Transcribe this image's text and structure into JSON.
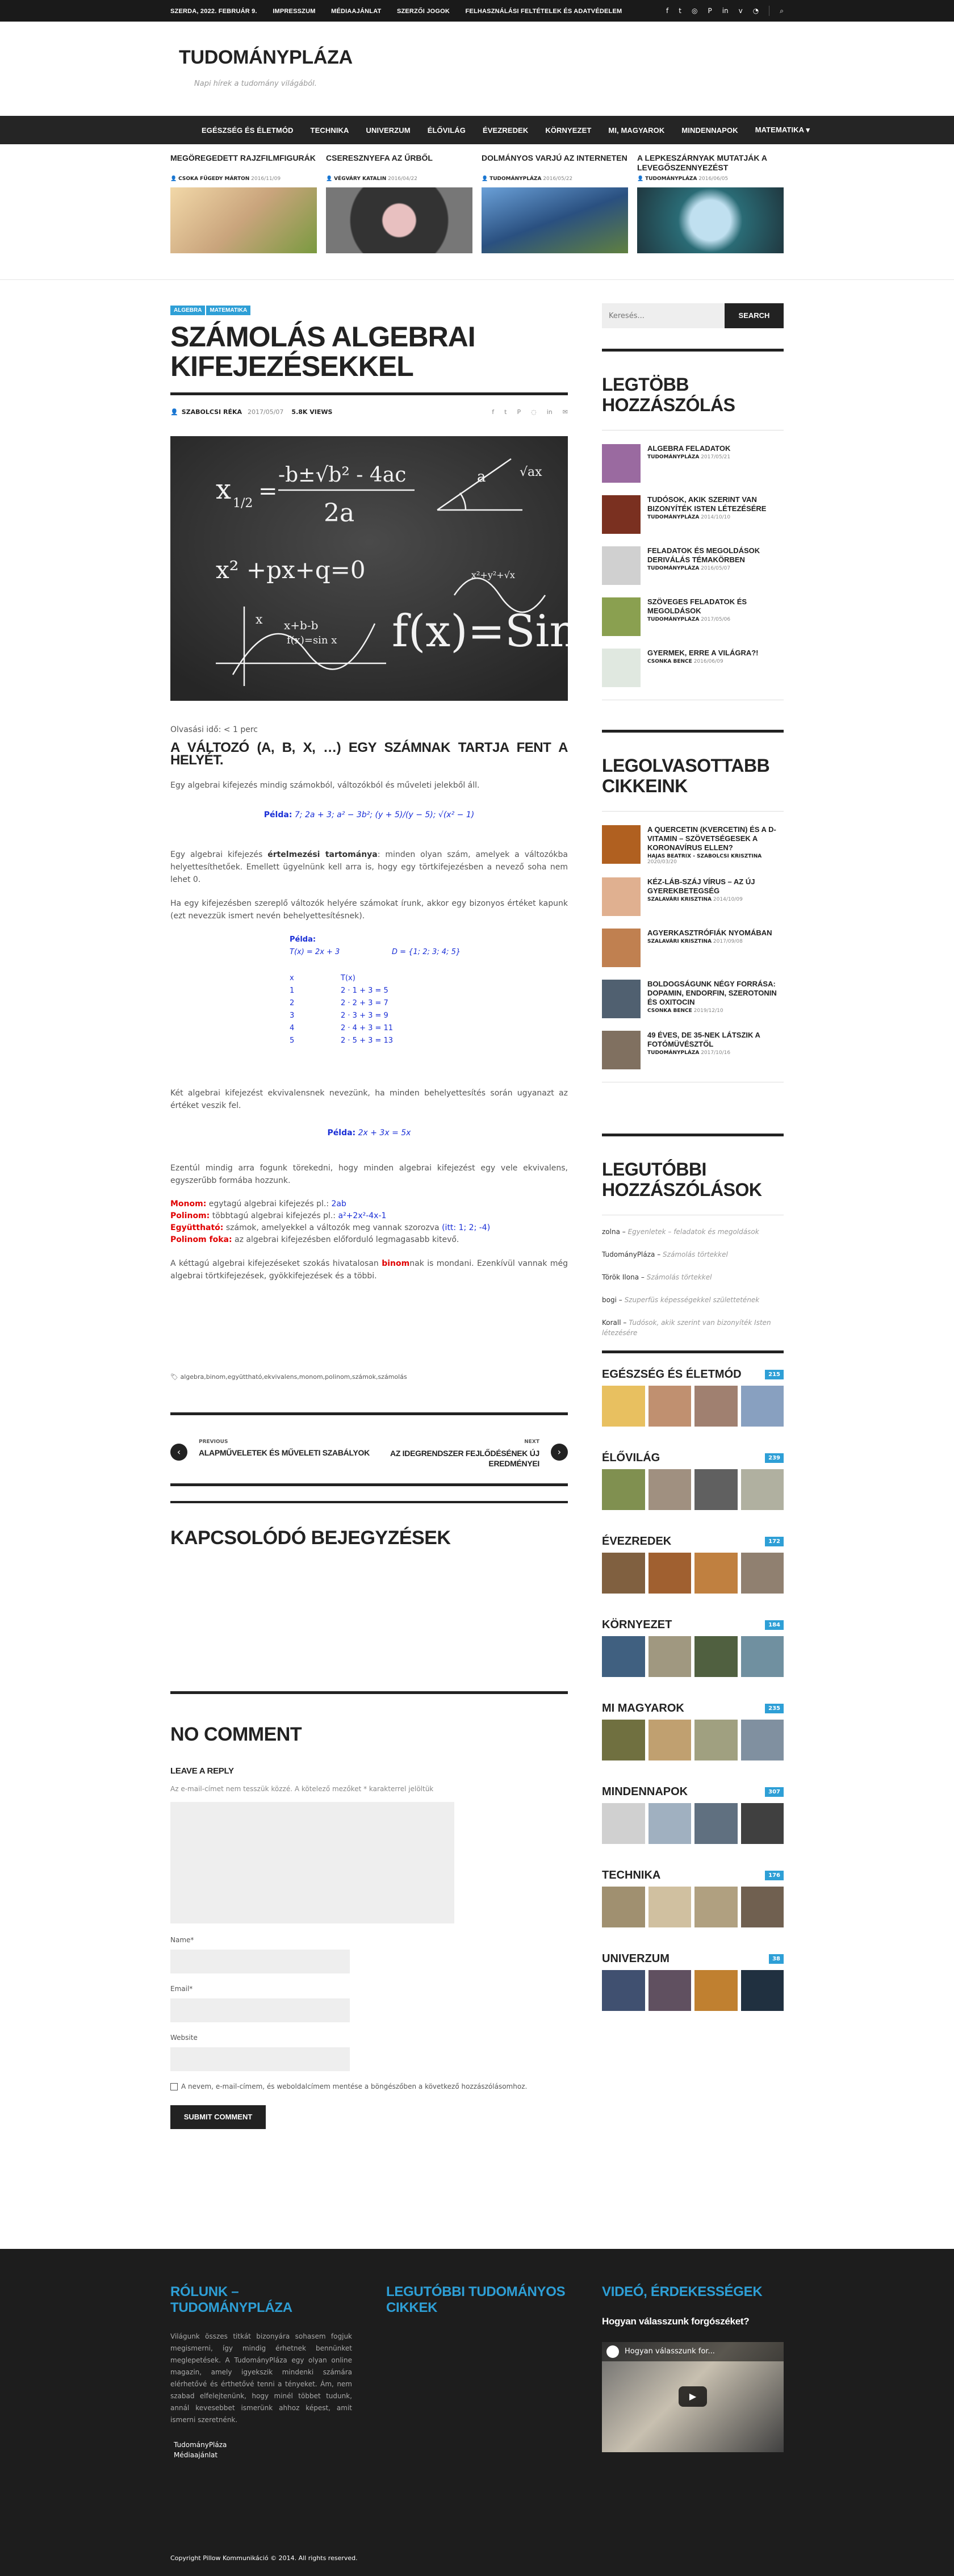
{
  "topbar": {
    "date": "SZERDA, 2022. FEBRUÁR 9.",
    "links": [
      "IMPRESSZUM",
      "MÉDIAAJÁNLAT",
      "SZERZŐI JOGOK",
      "FELHASZNÁLÁSI FELTÉTELEK ÉS ADATVÉDELEM"
    ],
    "social_icons": [
      "facebook-icon",
      "twitter-icon",
      "instagram-icon",
      "pinterest-icon",
      "linkedin-icon",
      "vimeo-icon",
      "rss-icon",
      "search-icon"
    ]
  },
  "header": {
    "logo": "TUDOMÁNYPLÁZA",
    "tagline": "Napi hírek a tudomány világából."
  },
  "nav": {
    "items": [
      "EGÉSZSÉG ÉS ÉLETMÓD",
      "TECHNIKA",
      "UNIVERZUM",
      "ÉLŐVILÁG",
      "ÉVEZREDEK",
      "KÖRNYEZET",
      "MI, MAGYAROK",
      "MINDENNAPOK",
      "MATEMATIKA ▾"
    ]
  },
  "featured": [
    {
      "title": "MEGÖREGEDETT RAJZFILMFIGURÁK",
      "author": "CSOKA FÜGEDY MÁRTON",
      "date": "2016/11/09",
      "color": "#c9a47c"
    },
    {
      "title": "CSERESZNYEFA AZ ŰRBŐL",
      "author": "VÉGVÁRY KATALIN",
      "date": "2016/04/22",
      "color": "#555"
    },
    {
      "title": "DOLMÁNYOS VARJÚ AZ INTERNETEN",
      "author": "TUDOMÁNYPLÁZA",
      "date": "2016/05/22",
      "color": "#3b6ea8"
    },
    {
      "title": "A LEPKESZÁRNYAK MUTATJÁK A LEVEGŐSZENNYEZÉST",
      "author": "TUDOMÁNYPLÁZA",
      "date": "2016/06/05",
      "color": "#2a6b75"
    }
  ],
  "article": {
    "categories": [
      "ALGEBRA",
      "MATEMATIKA"
    ],
    "title": "SZÁMOLÁS ALGEBRAI KIFEJEZÉSEKKEL",
    "author": "SZABOLCSI RÉKA",
    "date": "2017/05/07",
    "views": "5.8K VIEWS",
    "reading_time": "Olvasási idő: < 1 perc",
    "h_variable": "A VÁLTOZÓ (A, B, X, …) EGY SZÁMNAK TARTJA FENT A HELYÉT.",
    "p1": "Egy algebrai kifejezés mindig számokból, változókból és műveleti jelekből áll.",
    "example1_label": "Példa:",
    "example1": "7; 2a + 3; a² − 3b²; (y + 5)/(y − 5); √(x² − 1)",
    "p2_a": "Egy algebrai kifejezés ",
    "p2_b": "értelmezési tartománya",
    "p2_c": ": minden olyan szám, amelyek a változókba helyettesíthetőek. Emellett ügyelnünk kell arra is, hogy egy törtkifejezésben a nevező soha nem lehet 0.",
    "p3": "Ha egy kifejezésben szereplő változók helyére számokat írunk, akkor egy bizonyos értéket kapunk (ezt nevezzük ismert nevén behelyettesítésnek).",
    "example2_label": "Példa:",
    "example2_expr": "T(x) = 2x + 3",
    "example2_domain": "D = {1; 2; 3; 4; 5}",
    "table_headers": [
      "x",
      "T(x)"
    ],
    "table_rows": [
      [
        "1",
        "2 · 1 + 3 = 5"
      ],
      [
        "2",
        "2 · 2 + 3 = 7"
      ],
      [
        "3",
        "2 · 3 + 3 = 9"
      ],
      [
        "4",
        "2 · 4 + 3 = 11"
      ],
      [
        "5",
        "2 · 5 + 3 = 13"
      ]
    ],
    "p4": "Két algebrai kifejezést ekvivalensnek nevezünk, ha minden behelyettesítés során ugyanazt az értéket veszik fel.",
    "example3_label": "Példa:",
    "example3": "2x + 3x = 5x",
    "p5": "Ezentúl mindig arra fogunk törekedni, hogy minden algebrai kifejezést egy vele ekvivalens, egyszerűbb formába hozzunk.",
    "defs": [
      {
        "term": "Monom:",
        "text": " egytagú algebrai kifejezés pl.: ",
        "ex": "2ab"
      },
      {
        "term": "Polinom:",
        "text": " többtagú algebrai kifejezés pl.: ",
        "ex": "a²+2x²-4x-1"
      },
      {
        "term": "Együttható:",
        "text": " számok, amelyekkel a változók meg vannak szorozva ",
        "ex": "(itt: 1; 2; -4)"
      },
      {
        "term": "Polinom foka:",
        "text": " az algebrai kifejezésben előforduló legmagasabb kitevő.",
        "ex": ""
      }
    ],
    "p6_a": "A kéttagú algebrai kifejezéseket szokás hivatalosan ",
    "p6_b": "binom",
    "p6_c": "nak is mondani. Ezenkívül vannak még algebrai törtkifejezések, gyökkifejezések és a többi.",
    "tags": "algebra,binom,együttható,ekvivalens,monom,polinom,számok,számolás",
    "prev_label": "PREVIOUS",
    "prev_title": "ALAPMŰVELETEK ÉS MŰVELETI SZABÁLYOK",
    "next_label": "NEXT",
    "next_title": "AZ IDEGRENDSZER FEJLŐDÉSÉNEK ÚJ EREDMÉNYEI",
    "related_title": "KAPCSOLÓDÓ BEJEGYZÉSEK",
    "comments_title": "NO COMMENT",
    "reply_title": "LEAVE A REPLY",
    "reply_note": "Az e-mail-címet nem tesszük közzé. A kötelező mezőket * karakterrel jelöltük",
    "name_label": "Name*",
    "email_label": "Email*",
    "website_label": "Website",
    "cookie_label": "A nevem, e-mail-címem, és weboldalcímem mentése a böngészőben a következő hozzászólásomhoz.",
    "submit": "SUBMIT COMMENT"
  },
  "sidebar": {
    "search_placeholder": "Keresés...",
    "search_button": "SEARCH",
    "most_commented_title": "LEGTÖBB HOZZÁSZÓLÁS",
    "most_commented": [
      {
        "title": "ALGEBRA FELADATOK",
        "author": "TUDOMÁNYPLÁZA",
        "date": "2017/05/21",
        "color": "#9a6aa0"
      },
      {
        "title": "TUDÓSOK, AKIK SZERINT VAN BIZONYÍTÉK ISTEN LÉTEZÉSÉRE",
        "author": "TUDOMÁNYPLÁZA",
        "date": "2014/10/10",
        "color": "#7a3020"
      },
      {
        "title": "FELADATOK ÉS MEGOLDÁSOK DERIVÁLÁS TÉMAKÖRBEN",
        "author": "TUDOMÁNYPLÁZA",
        "date": "2016/05/07",
        "color": "#d0d0d0"
      },
      {
        "title": "SZÖVEGES FELADATOK ÉS MEGOLDÁSOK",
        "author": "TUDOMÁNYPLÁZA",
        "date": "2017/05/06",
        "color": "#8aa050"
      },
      {
        "title": "GYERMEK, ERRE A VILÁGRA?!",
        "author": "CSONKA BENCE",
        "date": "2016/06/09",
        "color": "#e0e8e0"
      }
    ],
    "most_read_title": "LEGOLVASOTTABB CIKKEINK",
    "most_read": [
      {
        "title": "A QUERCETIN (KVERCETIN) ÉS A D-VITAMIN – SZÖVETSÉGESEK A KORONAVÍRUS ELLEN?",
        "author": "HAJAS BEATRIX - SZABOLCSI KRISZTINA",
        "date": "2020/03/20",
        "color": "#b06020"
      },
      {
        "title": "KÉZ-LÁB-SZÁJ VÍRUS – AZ ÚJ GYEREKBETEGSÉG",
        "author": "SZALAVÁRI KRISZTINA",
        "date": "2014/10/09",
        "color": "#e0b090"
      },
      {
        "title": "AGYERKASZTRÓFIÁK NYOMÁBAN",
        "author": "SZALAVÁRI KRISZTINA",
        "date": "2017/09/08",
        "color": "#c08050"
      },
      {
        "title": "BOLDOGSÁGUNK NÉGY FORRÁSA: DOPAMIN, ENDORFIN, SZEROTONIN ÉS OXITOCIN",
        "author": "CSONKA BENCE",
        "date": "2019/12/10",
        "color": "#506070"
      },
      {
        "title": "49 ÉVES, DE 35-NEK LÁTSZIK A FOTÓMÜVÉSZTŐL",
        "author": "TUDOMÁNYPLÁZA",
        "date": "2017/10/16",
        "color": "#807060"
      }
    ],
    "recent_comments_title": "LEGUTÓBBI HOZZÁSZÓLÁSOK",
    "recent_comments": [
      {
        "who": "zolna",
        "sep": " – ",
        "what": "Egyenletek – feladatok és megoldások"
      },
      {
        "who": "TudományPláza",
        "sep": " – ",
        "what": "Számolás törtekkel"
      },
      {
        "who": "Török Ilona",
        "sep": " – ",
        "what": "Számolás törtekkel"
      },
      {
        "who": "bogi",
        "sep": " – ",
        "what": "Szuperfüs képességekkel születtetének"
      },
      {
        "who": "Korall",
        "sep": " – ",
        "what": "Tudósok, akik szerint van bizonyíték Isten létezésére"
      }
    ],
    "category_blocks": [
      {
        "name": "EGÉSZSÉG ÉS ÉLETMÓD",
        "count": "215",
        "colors": [
          "#e8c060",
          "#c09070",
          "#a08070",
          "#88a0c0"
        ]
      },
      {
        "name": "ÉLŐVILÁG",
        "count": "239",
        "colors": [
          "#809050",
          "#a09080",
          "#606060",
          "#b0b0a0"
        ]
      },
      {
        "name": "ÉVEZREDEK",
        "count": "172",
        "colors": [
          "#806040",
          "#a06030",
          "#c08040",
          "#908070"
        ]
      },
      {
        "name": "KÖRNYEZET",
        "count": "184",
        "colors": [
          "#406080",
          "#a09880",
          "#506040",
          "#7090a0"
        ]
      },
      {
        "name": "MI MAGYAROK",
        "count": "235",
        "colors": [
          "#707040",
          "#c0a070",
          "#a0a080",
          "#8090a0"
        ]
      },
      {
        "name": "MINDENNAPOK",
        "count": "307",
        "colors": [
          "#d0d0d0",
          "#a0b0c0",
          "#607080",
          "#404040"
        ]
      },
      {
        "name": "TECHNIKA",
        "count": "176",
        "colors": [
          "#a09070",
          "#d0c0a0",
          "#b0a080",
          "#706050"
        ]
      },
      {
        "name": "UNIVERZUM",
        "count": "38",
        "colors": [
          "#405070",
          "#605060",
          "#c08030",
          "#203040"
        ]
      }
    ]
  },
  "footer": {
    "about_title": "RÓLUNK – TUDOMÁNYPLÁZA",
    "about_text": "Világunk összes titkát bizonyára sohasem fogjuk megismerni, így mindig érhetnek bennünket meglepetések. A TudományPláza egy olyan online magazin, amely igyekszik mindenki számára elérhetővé és érthetővé tenni a tényeket. Ám, nem szabad elfelejtenünk, hogy minél többet tudunk, annál kevesebbet ismerünk ahhoz képest, amit ismerni szeretnénk.",
    "links": [
      "TudományPláza",
      "Médiaajánlat"
    ],
    "latest_title": "LEGUTÓBBI TUDOMÁNYOS CIKKEK",
    "video_title": "VIDEÓ, ÉRDEKESSÉGEK",
    "video_subtitle": "Hogyan válasszunk forgószéket?",
    "video_label": "Hogyan válasszunk for...",
    "copyright": "Copyright Pillow Kommunikáció © 2014. All rights reserved."
  },
  "colors": {
    "accent": "#2e9fd6",
    "dark": "#222222",
    "red": "#e00000",
    "blue": "#1a2fd6"
  }
}
